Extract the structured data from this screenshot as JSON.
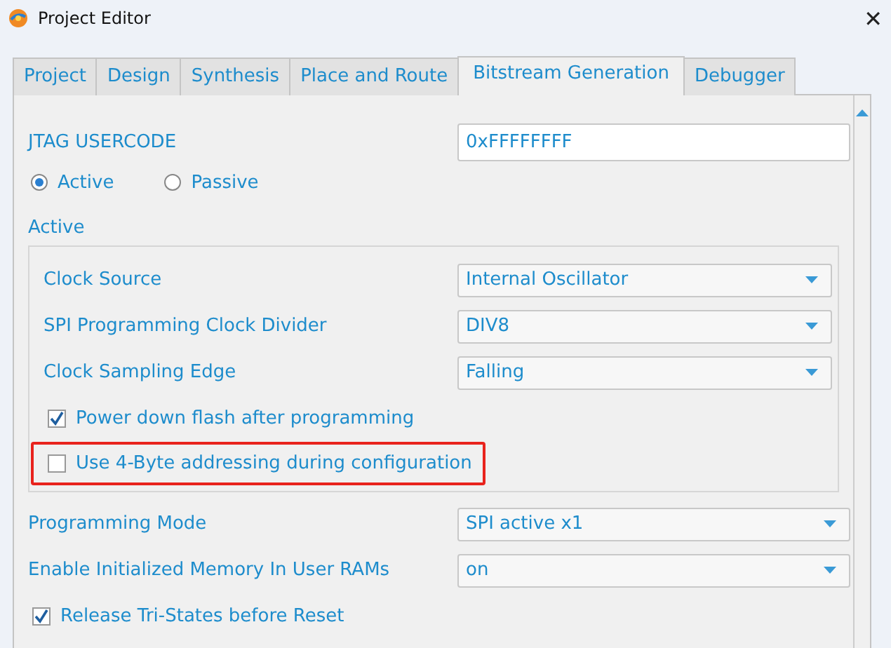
{
  "window": {
    "title": "Project Editor",
    "close": "✕"
  },
  "tabs": [
    {
      "label": "Project",
      "selected": false
    },
    {
      "label": "Design",
      "selected": false
    },
    {
      "label": "Synthesis",
      "selected": false
    },
    {
      "label": "Place and Route",
      "selected": false
    },
    {
      "label": "Bitstream Generation",
      "selected": true
    },
    {
      "label": "Debugger",
      "selected": false
    }
  ],
  "usercode": {
    "label": "JTAG USERCODE",
    "value": "0xFFFFFFFF"
  },
  "mode_radios": [
    {
      "label": "Active",
      "selected": true
    },
    {
      "label": "Passive",
      "selected": false
    }
  ],
  "active_group": {
    "title": "Active",
    "rows": [
      {
        "kind": "dropdown",
        "label": "Clock Source",
        "value": "Internal Oscillator"
      },
      {
        "kind": "dropdown",
        "label": "SPI Programming Clock Divider",
        "value": "DIV8"
      },
      {
        "kind": "dropdown",
        "label": "Clock Sampling Edge",
        "value": "Falling"
      },
      {
        "kind": "checkbox",
        "label": "Power down flash after programming",
        "checked": true,
        "highlighted": false
      },
      {
        "kind": "checkbox",
        "label": "Use 4-Byte addressing during configuration",
        "checked": false,
        "highlighted": true
      }
    ]
  },
  "rows": [
    {
      "kind": "dropdown",
      "label": "Programming Mode",
      "value": "SPI active x1"
    },
    {
      "kind": "dropdown",
      "label": "Enable Initialized Memory In User RAMs",
      "value": "on"
    },
    {
      "kind": "checkbox",
      "label": "Release Tri-States before Reset",
      "checked": true,
      "highlighted": false
    }
  ]
}
